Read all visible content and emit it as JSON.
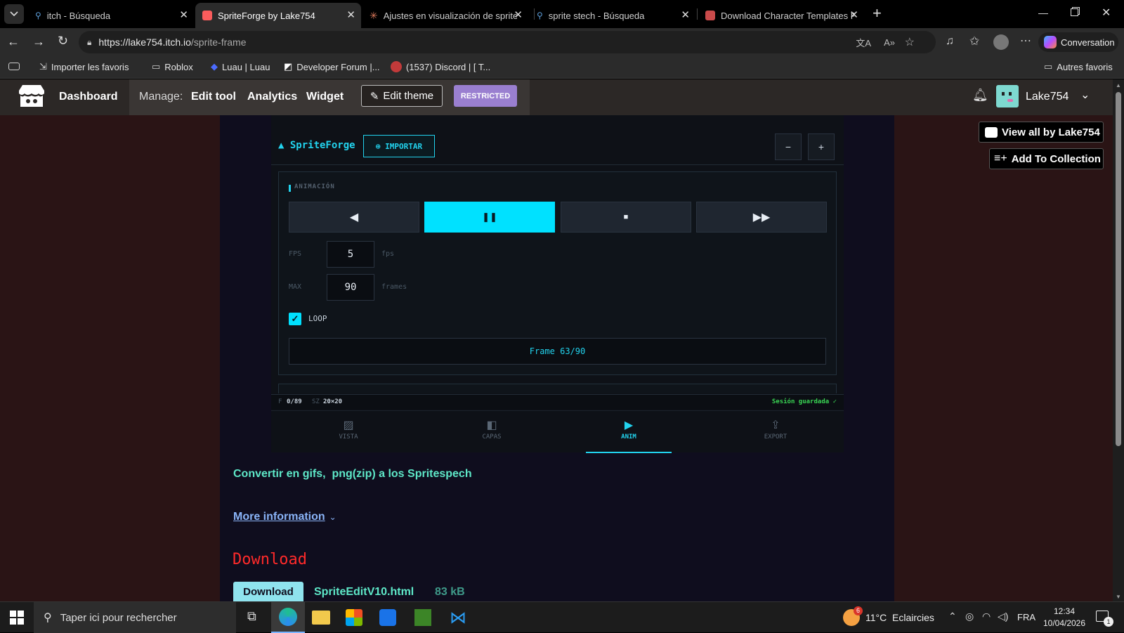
{
  "browser": {
    "tabs": [
      {
        "title": "itch - Búsqueda"
      },
      {
        "title": "SpriteForge by Lake754"
      },
      {
        "title": "Ajustes en visualización de sprites"
      },
      {
        "title": "sprite stech - Búsqueda"
      },
      {
        "title": "Download Character Templates Pa"
      }
    ],
    "url_host": "https://lake754.itch.io",
    "url_path": "/sprite-frame",
    "copilot_label": "Conversation",
    "bookmarks": [
      "Importer les favoris",
      "Roblox",
      "Luau | Luau",
      "Developer Forum |...",
      "(1537) Discord | [ T...",
      "Autres favoris"
    ]
  },
  "itch": {
    "dashboard": "Dashboard",
    "manage_label": "Manage:",
    "edit_tool": "Edit tool",
    "analytics": "Analytics",
    "widget": "Widget",
    "edit_theme": "Edit theme",
    "restricted": "RESTRICTED",
    "username": "Lake754",
    "view_all": "View all by Lake754",
    "add_collection": "Add To Collection"
  },
  "app": {
    "title": "▲ SpriteForge",
    "import_label": "⊕ IMPORTAR",
    "zoom_out": "−",
    "zoom_in": "+",
    "section": "ANIMACIÓN",
    "fps_label": "FPS",
    "fps_value": "5",
    "fps_unit": "fps",
    "max_label": "MAX",
    "max_value": "90",
    "max_unit": "frames",
    "loop_label": "LOOP",
    "frame_display": "Frame 63/90",
    "status_f_label": "F",
    "status_f": "0/89",
    "status_sz_label": "SZ",
    "status_sz": "20×20",
    "session": "Sesión guardada ✓",
    "nav": [
      "VISTA",
      "CAPAS",
      "ANIM",
      "EXPORT"
    ]
  },
  "content": {
    "description": "Convertir en gifs,  png(zip) a los Spritespech",
    "more_info": "More information",
    "download_heading": "Download",
    "download_button": "Download",
    "file_name": "SpriteEditV10.html",
    "file_size": "83 kB"
  },
  "taskbar": {
    "search": "Taper ici pour rechercher",
    "weather": "11°C  Eclaircies",
    "lang": "FRA",
    "time": "12:34",
    "date": "10/04/2026",
    "weather_badge": "6",
    "notif_count": "1"
  }
}
